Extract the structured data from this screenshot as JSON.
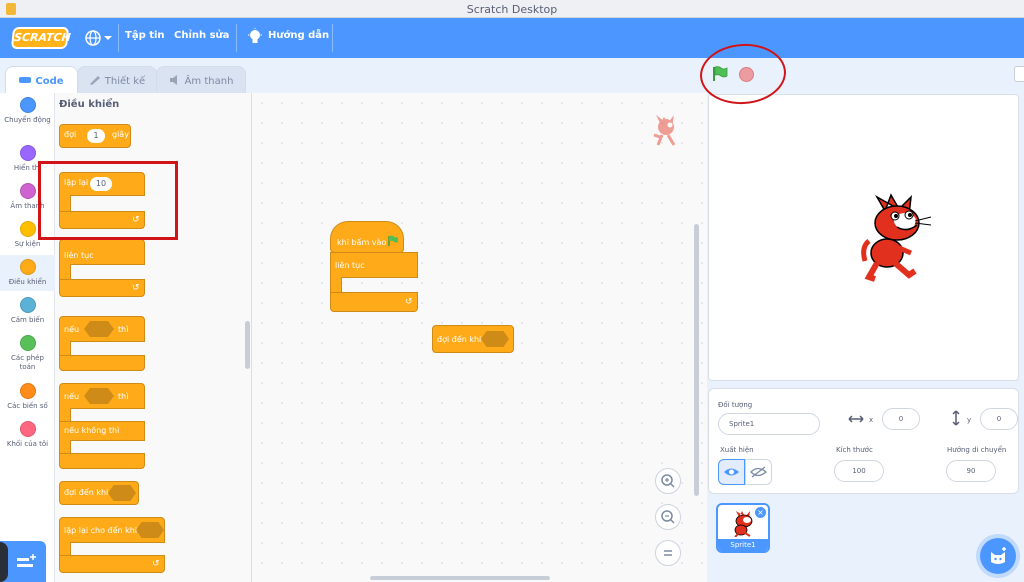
{
  "window": {
    "title": "Scratch Desktop"
  },
  "menu": {
    "logo": "SCRATCH",
    "file": "Tập tin",
    "edit": "Chỉnh sửa",
    "tutorials": "Hướng dẫn"
  },
  "tabs": [
    {
      "label": "Code"
    },
    {
      "label": "Thiết kế"
    },
    {
      "label": "Âm thanh"
    }
  ],
  "categories": [
    {
      "label": "Chuyển động",
      "color": "#4c97ff"
    },
    {
      "label": "Hiển thị",
      "color": "#9966ff"
    },
    {
      "label": "Âm thanh",
      "color": "#cf63cf"
    },
    {
      "label": "Sự kiện",
      "color": "#ffbf00"
    },
    {
      "label": "Điều khiển",
      "color": "#ffab19"
    },
    {
      "label": "Cảm biến",
      "color": "#5cb1d6"
    },
    {
      "label": "Các phép toán",
      "color": "#59c059"
    },
    {
      "label": "Các biến số",
      "color": "#ff8c1a"
    },
    {
      "label": "Khối của tôi",
      "color": "#ff6680"
    }
  ],
  "palette": {
    "title": "Điều khiển",
    "blocks": {
      "wait": {
        "label": "đợi",
        "value": "1",
        "unit": "giây"
      },
      "repeat": {
        "label": "lặp lại",
        "value": "10"
      },
      "forever": {
        "label": "liên tục"
      },
      "if_then": {
        "label": "nếu",
        "then": "thì"
      },
      "if_else": {
        "label": "nếu",
        "then": "thì",
        "else": "nếu không thì"
      },
      "wait_until": {
        "label": "đợi đến khi"
      },
      "repeat_until": {
        "label": "lặp lại cho đến khi"
      }
    }
  },
  "script": {
    "hat": "khi bấm vào",
    "forever": "liên tục",
    "wait_until": "đợi đến khi"
  },
  "sprite_info": {
    "sprite_label": "Đối tượng",
    "sprite_name": "Sprite1",
    "x_label": "x",
    "x_value": "0",
    "y_label": "y",
    "y_value": "0",
    "show_label": "Xuất hiện",
    "size_label": "Kích thước",
    "size_value": "100",
    "direction_label": "Hướng di chuyển",
    "direction_value": "90"
  },
  "sprites": [
    {
      "name": "Sprite1"
    }
  ],
  "colors": {
    "accent": "#4c97ff",
    "control": "#ffab19",
    "annotation": "#d01418"
  }
}
